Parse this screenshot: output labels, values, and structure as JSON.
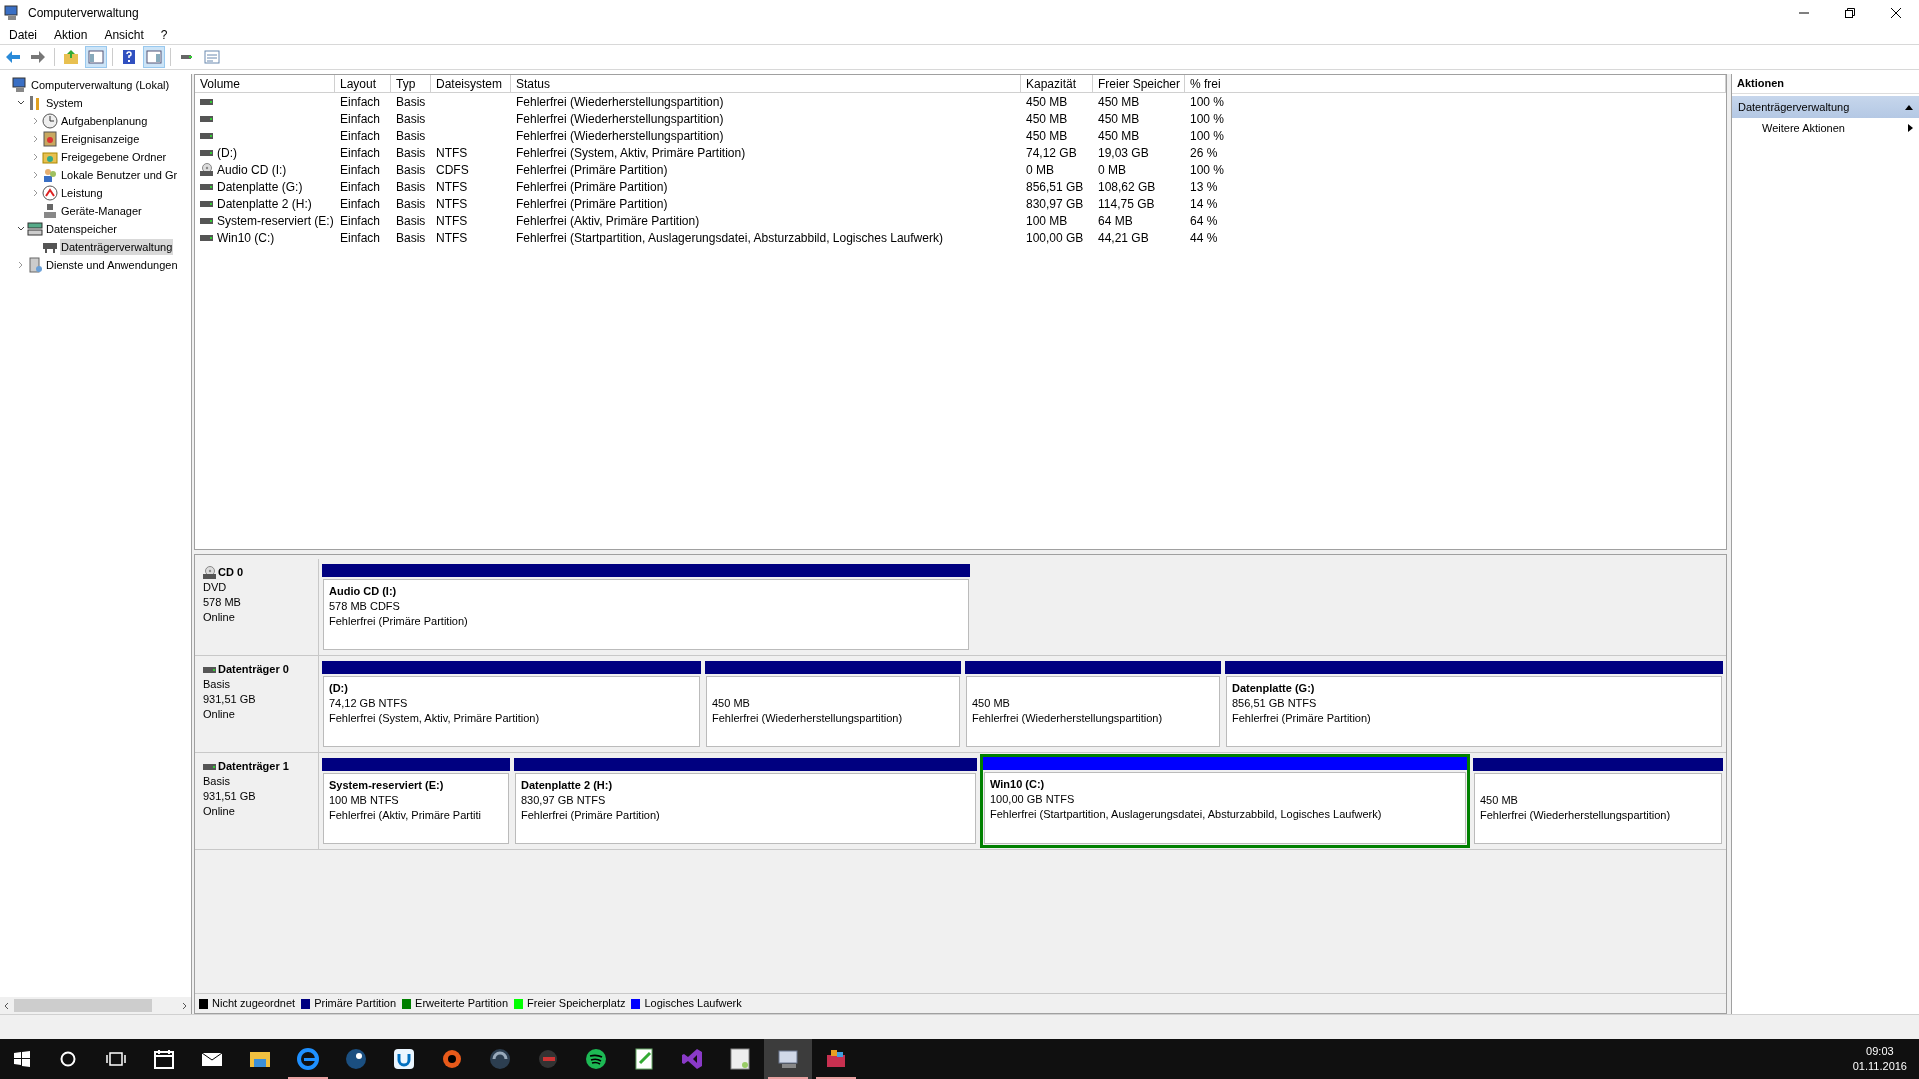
{
  "window": {
    "title": "Computerverwaltung"
  },
  "menu": [
    "Datei",
    "Aktion",
    "Ansicht",
    "?"
  ],
  "toolbar": [
    {
      "pressed": false
    },
    {
      "pressed": false
    },
    {
      "pressed": false
    },
    {
      "pressed": true
    },
    {
      "pressed": false
    },
    {
      "pressed": true
    },
    {
      "pressed": false
    },
    {
      "pressed": false
    }
  ],
  "tree": [
    {
      "label": "Computerverwaltung (Lokal)",
      "selected": false,
      "children": [
        {
          "label": "System",
          "expanded": true,
          "selected": false,
          "children": [
            {
              "label": "Aufgabenplanung",
              "expanded": false,
              "selected": false
            },
            {
              "label": "Ereignisanzeige",
              "expanded": false,
              "selected": false
            },
            {
              "label": "Freigegebene Ordner",
              "expanded": false,
              "selected": false
            },
            {
              "label": "Lokale Benutzer und Gr",
              "expanded": false,
              "selected": false
            },
            {
              "label": "Leistung",
              "expanded": false,
              "selected": false
            },
            {
              "label": "Geräte-Manager",
              "selected": false
            }
          ]
        },
        {
          "label": "Datenspeicher",
          "expanded": true,
          "selected": false,
          "children": [
            {
              "label": "Datenträgerverwaltung",
              "selected": true
            }
          ]
        },
        {
          "label": "Dienste und Anwendungen",
          "expanded": false,
          "selected": false
        }
      ]
    }
  ],
  "table": {
    "columns": [
      "Volume",
      "Layout",
      "Typ",
      "Dateisystem",
      "Status",
      "Kapazität",
      "Freier Speicher",
      "% frei"
    ],
    "rows": [
      {
        "kind": "disk",
        "cells": [
          "",
          "Einfach",
          "Basis",
          "",
          "Fehlerfrei (Wiederherstellungspartition)",
          "450 MB",
          "450 MB",
          "100 %"
        ]
      },
      {
        "kind": "disk",
        "cells": [
          "",
          "Einfach",
          "Basis",
          "",
          "Fehlerfrei (Wiederherstellungspartition)",
          "450 MB",
          "450 MB",
          "100 %"
        ]
      },
      {
        "kind": "disk",
        "cells": [
          "",
          "Einfach",
          "Basis",
          "",
          "Fehlerfrei (Wiederherstellungspartition)",
          "450 MB",
          "450 MB",
          "100 %"
        ]
      },
      {
        "kind": "disk",
        "cells": [
          "(D:)",
          "Einfach",
          "Basis",
          "NTFS",
          "Fehlerfrei (System, Aktiv, Primäre Partition)",
          "74,12 GB",
          "19,03 GB",
          "26 %"
        ]
      },
      {
        "kind": "cd",
        "cells": [
          "Audio CD (I:)",
          "Einfach",
          "Basis",
          "CDFS",
          "Fehlerfrei (Primäre Partition)",
          "0 MB",
          "0 MB",
          "100 %"
        ]
      },
      {
        "kind": "disk",
        "cells": [
          "Datenplatte (G:)",
          "Einfach",
          "Basis",
          "NTFS",
          "Fehlerfrei (Primäre Partition)",
          "856,51 GB",
          "108,62 GB",
          "13 %"
        ]
      },
      {
        "kind": "disk",
        "cells": [
          "Datenplatte 2 (H:)",
          "Einfach",
          "Basis",
          "NTFS",
          "Fehlerfrei (Primäre Partition)",
          "830,97 GB",
          "114,75 GB",
          "14 %"
        ]
      },
      {
        "kind": "disk",
        "cells": [
          "System-reserviert (E:)",
          "Einfach",
          "Basis",
          "NTFS",
          "Fehlerfrei (Aktiv, Primäre Partition)",
          "100 MB",
          "64 MB",
          "64 %"
        ]
      },
      {
        "kind": "disk",
        "cells": [
          "Win10 (C:)",
          "Einfach",
          "Basis",
          "NTFS",
          "Fehlerfrei (Startpartition, Auslagerungsdatei, Absturzabbild, Logisches Laufwerk)",
          "100,00 GB",
          "44,21 GB",
          "44 %"
        ]
      }
    ]
  },
  "disks": [
    {
      "name": "CD 0",
      "kind": "cd",
      "lines": [
        "DVD",
        "578 MB",
        "Online"
      ],
      "partitions": [
        {
          "name": "Audio CD  (I:)",
          "size": "578 MB CDFS",
          "status": "Fehlerfrei (Primäre Partition)",
          "kind": "primary",
          "selected": false
        }
      ]
    },
    {
      "name": "Datenträger 0",
      "kind": "disk",
      "lines": [
        "Basis",
        "931,51 GB",
        "Online"
      ],
      "partitions": [
        {
          "name": "(D:)",
          "size": "74,12 GB NTFS",
          "status": "Fehlerfrei (System, Aktiv, Primäre Partition)",
          "kind": "primary",
          "selected": false
        },
        {
          "size": "450 MB",
          "status": "Fehlerfrei (Wiederherstellungspartition)",
          "kind": "primary",
          "selected": false
        },
        {
          "size": "450 MB",
          "status": "Fehlerfrei (Wiederherstellungspartition)",
          "kind": "primary",
          "selected": false
        },
        {
          "name": "Datenplatte  (G:)",
          "size": "856,51 GB NTFS",
          "status": "Fehlerfrei (Primäre Partition)",
          "kind": "primary",
          "selected": false
        }
      ]
    },
    {
      "name": "Datenträger 1",
      "kind": "disk",
      "lines": [
        "Basis",
        "931,51 GB",
        "Online"
      ],
      "partitions": [
        {
          "name": "System-reserviert  (E:)",
          "size": "100 MB NTFS",
          "status": "Fehlerfrei (Aktiv, Primäre Partiti",
          "kind": "primary",
          "selected": false
        },
        {
          "name": "Datenplatte 2  (H:)",
          "size": "830,97 GB NTFS",
          "status": "Fehlerfrei (Primäre Partition)",
          "kind": "primary",
          "selected": false
        },
        {
          "name": "Win10  (C:)",
          "size": "100,00 GB NTFS",
          "status": "Fehlerfrei (Startpartition, Auslagerungsdatei, Absturzabbild, Logisches Laufwerk)",
          "kind": "logical",
          "selected": true
        },
        {
          "size": "450 MB",
          "status": "Fehlerfrei (Wiederherstellungspartition)",
          "kind": "primary",
          "selected": false
        }
      ]
    }
  ],
  "legend": [
    {
      "label": "Nicht zugeordnet",
      "color": "#000000"
    },
    {
      "label": "Primäre Partition",
      "color": "#000080"
    },
    {
      "label": "Erweiterte Partition",
      "color": "#008000"
    },
    {
      "label": "Freier Speicherplatz",
      "color": "#00ff00"
    },
    {
      "label": "Logisches Laufwerk",
      "color": "#0000ff"
    }
  ],
  "actions": {
    "title": "Aktionen",
    "section": "Datenträgerverwaltung",
    "items": [
      "Weitere Aktionen"
    ]
  },
  "taskbar": {
    "apps": [
      {
        "running": false,
        "active": false
      },
      {
        "running": false,
        "active": false
      },
      {
        "running": false,
        "active": false
      },
      {
        "running": true,
        "active": false
      },
      {
        "running": false,
        "active": false
      },
      {
        "running": false,
        "active": false
      },
      {
        "running": false,
        "active": false
      },
      {
        "running": false,
        "active": false
      },
      {
        "running": false,
        "active": false
      },
      {
        "running": false,
        "active": false
      },
      {
        "running": false,
        "active": false
      },
      {
        "running": false,
        "active": false
      },
      {
        "running": false,
        "active": false
      },
      {
        "running": true,
        "active": true
      },
      {
        "running": true,
        "active": false
      }
    ],
    "time": "09:03",
    "date": "01.11.2016"
  }
}
